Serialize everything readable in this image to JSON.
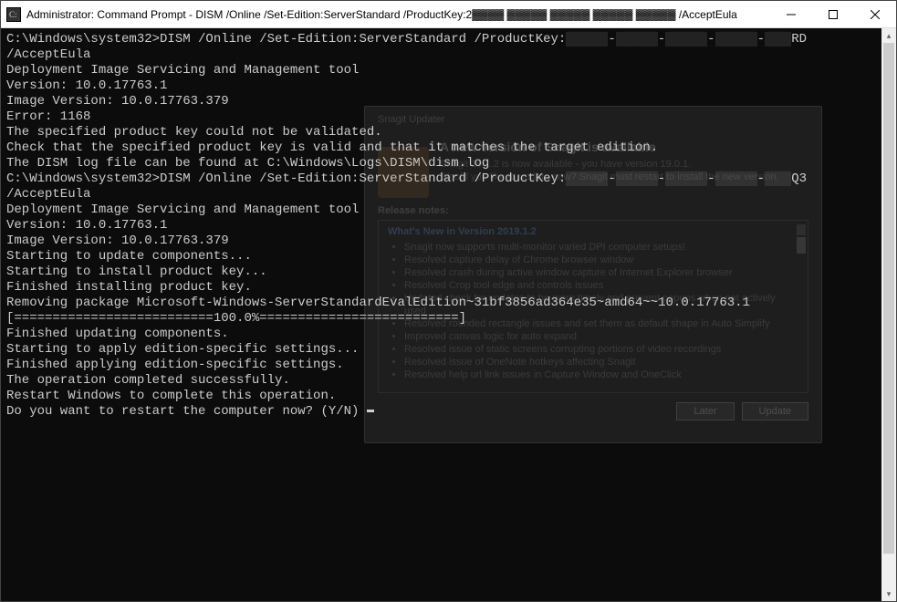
{
  "window": {
    "title": "Administrator: Command Prompt - DISM  /Online /Set-Edition:ServerStandard /ProductKey:2▓▓▓▓ ▓▓▓▓▓ ▓▓▓▓▓ ▓▓▓▓▓ ▓▓▓▓▓ /AcceptEula"
  },
  "terminal": {
    "lines": [
      "",
      "C:\\Windows\\system32>DISM /Online /Set-Edition:ServerStandard /ProductKey:▓▓▓▓▓-▓▓▓▓▓-▓▓▓▓▓-▓▓▓▓▓-▓▓▓RD /AcceptEula",
      "",
      "Deployment Image Servicing and Management tool",
      "Version: 10.0.17763.1",
      "",
      "Image Version: 10.0.17763.379",
      "",
      "",
      "Error: 1168",
      "",
      "The specified product key could not be validated.",
      "Check that the specified product key is valid and that it matches the target edition.",
      "",
      "The DISM log file can be found at C:\\Windows\\Logs\\DISM\\dism.log",
      "",
      "C:\\Windows\\system32>DISM /Online /Set-Edition:ServerStandard /ProductKey:▓▓▓▓▓-▓▓▓▓▓-▓▓▓▓▓-▓▓▓▓▓-▓▓▓Q3 /AcceptEula",
      "",
      "Deployment Image Servicing and Management tool",
      "Version: 10.0.17763.1",
      "",
      "Image Version: 10.0.17763.379",
      "",
      "Starting to update components...",
      "Starting to install product key...",
      "Finished installing product key.",
      "",
      "Removing package Microsoft-Windows-ServerStandardEvalEdition~31bf3856ad364e35~amd64~~10.0.17763.1",
      "[==========================100.0%==========================]",
      "Finished updating components.",
      "",
      "Starting to apply edition-specific settings...",
      "Finished applying edition-specific settings.",
      "",
      "The operation completed successfully.",
      "Restart Windows to complete this operation.",
      "Do you want to restart the computer now? (Y/N) "
    ]
  },
  "ghost": {
    "updater_label": "Snagit Updater",
    "heading": "A new version of Snagit is available",
    "sub1": "Snagit 19.1.2 is now available - you have version 19.0.1.",
    "sub2": "Would you like to update now? Snagit must restart to install the new version.",
    "release_notes_label": "Release notes:",
    "box_title": "What's New in Version 2019.1.2",
    "bullets": [
      "Snagit now supports multi-monitor varied DPI computer setups!",
      "Resolved capture delay of Chrome browser window",
      "Resolved crash during active window capture of Internet Explorer browser",
      "Resolved Crop tool edge and controls issues",
      "Updated check for updates to be more timely and prevent popups when not actively used",
      "Resolved rounded rectangle issues and set them as default shape in Auto Simplify",
      "Improved canvas logic for auto expand",
      "Resolved issue of static screens corrupting portions of video recordings",
      "Resolved issue of OneNote hotkeys affecting Snagit",
      "Resolved help url link issues in Capture Window and OneClick"
    ],
    "later_label": "Later",
    "update_label": "Update"
  }
}
